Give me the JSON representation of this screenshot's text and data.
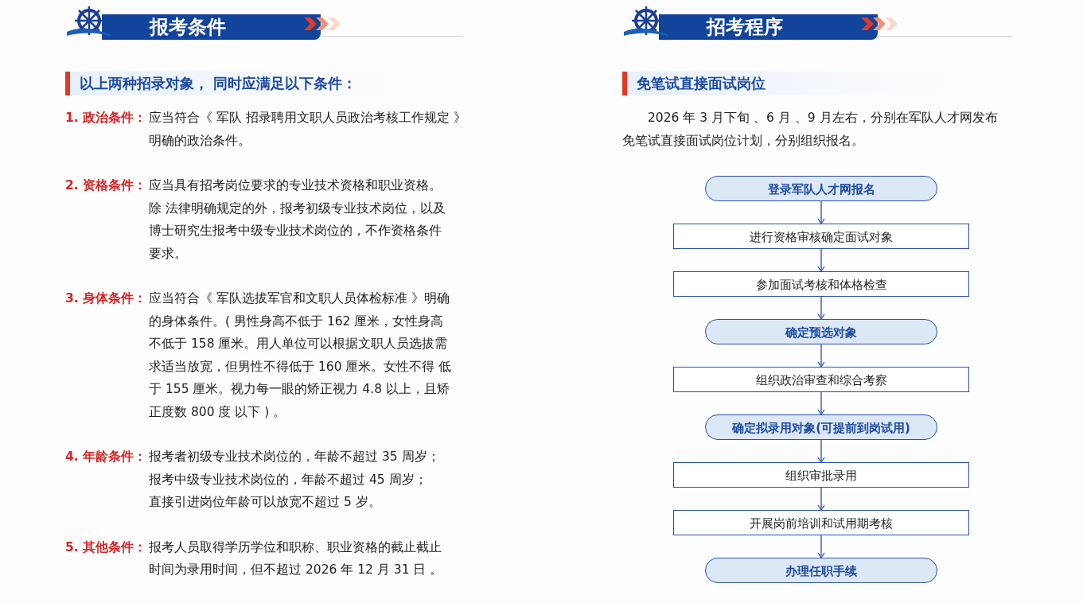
{
  "left": {
    "section_title": "报考条件",
    "subheading": "以上两种招录对象， 同时应满足以下条件：",
    "conditions": [
      {
        "label": "1. 政治条件：",
        "lines": [
          "应当符合《 军队 招录聘用文职人员政治考核工作规定 》",
          "明确的政治条件。"
        ]
      },
      {
        "label": "2. 资格条件：",
        "lines": [
          "应当具有招考岗位要求的专业技术资格和职业资格。",
          "除 法律明确规定的外，报考初级专业技术岗位，以及",
          "博士研究生报考中级专业技术岗位的，不作资格条件",
          "要求。"
        ]
      },
      {
        "label": "3. 身体条件：",
        "lines": [
          "应当符合《 军队选拔军官和文职人员体检标准 》明确",
          "的身体条件。( 男性身高不低于 162 厘米，女性身高",
          "不低于 158 厘米。用人单位可以根据文职人员选拔需",
          "求适当放宽，但男性不得低于 160 厘米。女性不得 低",
          "于 155 厘米。视力每一眼的矫正视力 4.8 以上，且矫",
          "正度数 800 度 以下 ) 。"
        ]
      },
      {
        "label": "4. 年龄条件：",
        "lines": [
          "报考者初级专业技术岗位的，年龄不超过 35 周岁；",
          "报考中级专业技术岗位的，年龄不超过 45 周岁；",
          "直接引进岗位年龄可以放宽不超过 5 岁。"
        ]
      },
      {
        "label": "5. 其他条件：",
        "lines": [
          "报考人员取得学历学位和职称、职业资格的截止截止",
          "时间为录用时间，但不超过 2026 年 12 月 31 日 。"
        ]
      }
    ]
  },
  "right": {
    "section_title": "招考程序",
    "subheading": "免笔试直接面试岗位",
    "intro_lines": [
      "2026 年 3 月下旬 、6 月 、9 月左右，分别在军队人才网发布",
      "免笔试直接面试岗位计划，分别组织报名。"
    ],
    "flow_steps": [
      {
        "kind": "milestone",
        "text": "登录军队人才网报名"
      },
      {
        "kind": "step",
        "text": "进行资格审核确定面试对象"
      },
      {
        "kind": "step",
        "text": "参加面试考核和体格检查"
      },
      {
        "kind": "milestone",
        "text": "确定预选对象"
      },
      {
        "kind": "step",
        "text": "组织政治审查和综合考察"
      },
      {
        "kind": "milestone",
        "text": "确定拟录用对象(可提前到岗试用)"
      },
      {
        "kind": "step",
        "text": "组织审批录用"
      },
      {
        "kind": "step",
        "text": "开展岗前培训和试用期考核"
      },
      {
        "kind": "milestone",
        "text": "办理任职手续"
      }
    ]
  }
}
